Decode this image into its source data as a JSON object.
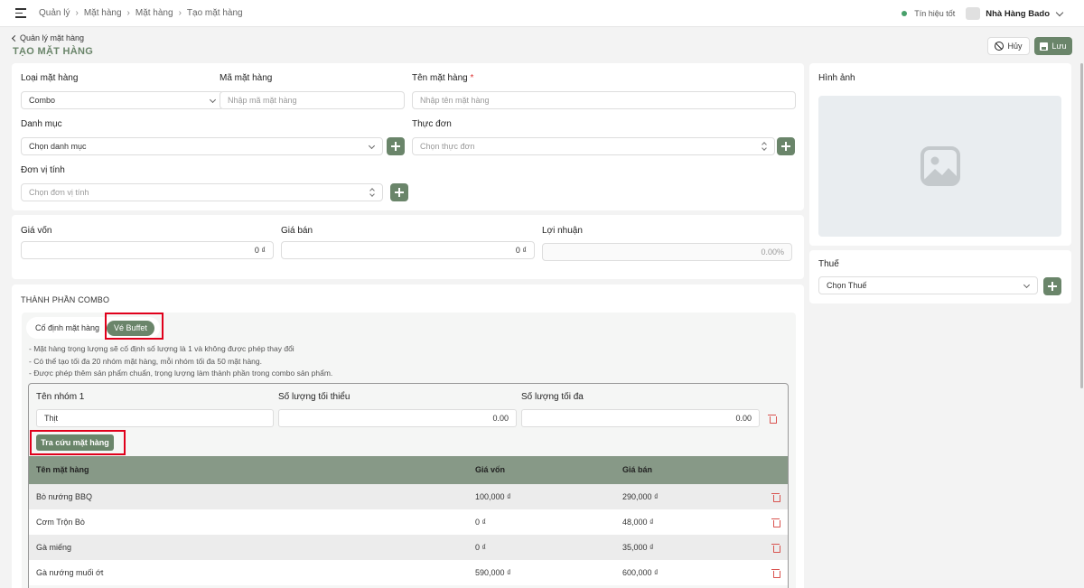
{
  "breadcrumb": [
    "Quản lý",
    "Mặt hàng",
    "Mặt hàng",
    "Tạo mặt hàng"
  ],
  "header": {
    "signal": "Tín hiệu tốt",
    "store": "Nhà Hàng Bado"
  },
  "page": {
    "back_label": "Quản lý mặt hàng",
    "title": "TẠO MẶT HÀNG",
    "cancel_label": "Hủy",
    "save_label": "Lưu"
  },
  "general": {
    "type_label": "Loại mặt hàng",
    "type_value": "Combo",
    "code_label": "Mã mặt hàng",
    "code_placeholder": "Nhập mã mặt hàng",
    "name_label": "Tên mặt hàng",
    "name_required": "*",
    "name_placeholder": "Nhập tên mặt hàng",
    "category_label": "Danh mục",
    "category_placeholder": "Chọn danh mục",
    "menu_label": "Thực đơn",
    "menu_placeholder": "Chọn thực đơn",
    "unit_label": "Đơn vị tính",
    "unit_placeholder": "Chọn đơn vị tính"
  },
  "pricing": {
    "cost_label": "Giá vốn",
    "cost_value": "0 ₫",
    "price_label": "Giá bán",
    "price_value": "0 ₫",
    "profit_label": "Lợi nhuận",
    "profit_value": "0.00%"
  },
  "image": {
    "label": "Hình ảnh"
  },
  "tax": {
    "label": "Thuế",
    "placeholder": "Chọn Thuế"
  },
  "combo": {
    "section_title": "THÀNH PHẦN COMBO",
    "toggle_fixed": "Cố định mặt hàng",
    "toggle_buffet": "Vé Buffet",
    "notes": [
      "- Mặt hàng trọng lượng sẽ cố định số lượng là 1 và không được phép thay đổi",
      "- Có thể tạo tối đa 20 nhóm mặt hàng, mỗi nhóm tối đa 50 mặt hàng.",
      "- Được phép thêm sản phẩm chuẩn, trọng lượng làm thành phần trong combo sản phẩm."
    ],
    "group": {
      "name_label": "Tên nhóm 1",
      "name_value": "Thịt",
      "min_label": "Số lượng tối thiểu",
      "min_value": "0.00",
      "max_label": "Số lượng tối đa",
      "max_value": "0.00",
      "lookup_label": "Tra cứu mặt hàng"
    },
    "table": {
      "columns": [
        "Tên mặt hàng",
        "Giá vốn",
        "Giá bán"
      ],
      "rows": [
        [
          "Bò nướng BBQ",
          "100,000 ₫",
          "290,000 ₫"
        ],
        [
          "Cơm Trộn Bò",
          "0 ₫",
          "48,000 ₫"
        ],
        [
          "Gà miếng",
          "0 ₫",
          "35,000 ₫"
        ],
        [
          "Gà nướng muối ớt",
          "590,000 ₫",
          "600,000 ₫"
        ]
      ]
    }
  }
}
